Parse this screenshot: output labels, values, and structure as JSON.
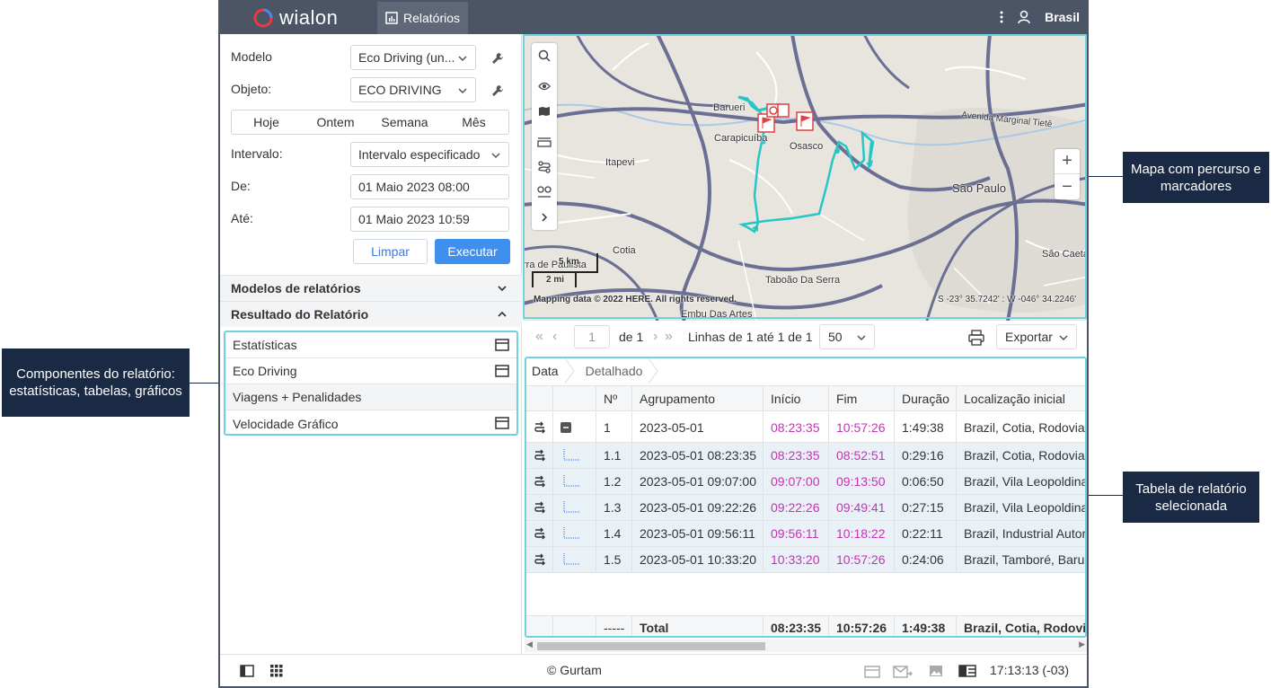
{
  "callouts": {
    "components": "Componentes do relatório: estatísticas, tabelas, gráficos",
    "map": "Mapa com percurso e marcadores",
    "table": "Tabela de relatório selecionada"
  },
  "header": {
    "logo": "wialon",
    "active_tab": "Relatórios",
    "user": "Brasil"
  },
  "form": {
    "model_label": "Modelo",
    "model_value": "Eco Driving (un...",
    "object_label": "Objeto:",
    "object_value": "ECO DRIVING",
    "periods": [
      "Hoje",
      "Ontem",
      "Semana",
      "Mês"
    ],
    "interval_label": "Intervalo:",
    "interval_value": "Intervalo especificado",
    "from_label": "De:",
    "from_value": "01 Maio 2023 08:00",
    "to_label": "Até:",
    "to_value": "01 Maio 2023 10:59",
    "clear_label": "Limpar",
    "run_label": "Executar"
  },
  "sections": {
    "templates": "Modelos de relatórios",
    "result": "Resultado do Relatório"
  },
  "components": [
    {
      "label": "Estatísticas",
      "icon": "table-icon"
    },
    {
      "label": "Eco Driving",
      "icon": "table-icon"
    },
    {
      "label": "Viagens + Penalidades",
      "icon": ""
    },
    {
      "label": "Velocidade Gráfico",
      "icon": "table-icon"
    }
  ],
  "map": {
    "labels": {
      "barueri": "Barueri",
      "carapicuiba": "Carapicuíba",
      "osasco": "Osasco",
      "itapevi": "Itapevi",
      "sao_paulo": "São Paulo",
      "cotia": "Cotia",
      "taboao": "Taboão Da Serra",
      "embu": "Embu Das Artes",
      "sao_caetano": "São Caeta",
      "paulista": "rra de Paulista",
      "marginal": "Avenida Marginal Tietê"
    },
    "scale_km": "5 km",
    "scale_mi": "2 mi",
    "attribution": "Mapping data © 2022 HERE. All rights reserved.",
    "coords": "S -23° 35.7242' : W -046° 34.2246'"
  },
  "toolbar": {
    "page": "1",
    "of_pages": "de 1",
    "rows_info": "Linhas de 1 até 1 de 1",
    "per_page": "50",
    "export_label": "Exportar"
  },
  "table": {
    "tabs": [
      "Data",
      "Detalhado"
    ],
    "columns": [
      "Nº",
      "Agrupamento",
      "Início",
      "Fim",
      "Duração",
      "Localização inicial"
    ],
    "rows": [
      {
        "n": "1",
        "group": "2023-05-01",
        "start": "08:23:35",
        "end": "10:57:26",
        "dur": "1:49:38",
        "loc": "Brazil, Cotia, Rodovia"
      },
      {
        "n": "1.1",
        "group": "2023-05-01 08:23:35",
        "start": "08:23:35",
        "end": "08:52:51",
        "dur": "0:29:16",
        "loc": "Brazil, Cotia, Rodovia"
      },
      {
        "n": "1.2",
        "group": "2023-05-01 09:07:00",
        "start": "09:07:00",
        "end": "09:13:50",
        "dur": "0:06:50",
        "loc": "Brazil, Vila Leopoldina"
      },
      {
        "n": "1.3",
        "group": "2023-05-01 09:22:26",
        "start": "09:22:26",
        "end": "09:49:41",
        "dur": "0:27:15",
        "loc": "Brazil, Vila Leopoldina"
      },
      {
        "n": "1.4",
        "group": "2023-05-01 09:56:11",
        "start": "09:56:11",
        "end": "10:18:22",
        "dur": "0:22:11",
        "loc": "Brazil, Industrial Autor"
      },
      {
        "n": "1.5",
        "group": "2023-05-01 10:33:20",
        "start": "10:33:20",
        "end": "10:57:26",
        "dur": "0:24:06",
        "loc": "Brazil, Tamboré, Barue"
      }
    ],
    "total": {
      "n": "-----",
      "group": "Total",
      "start": "08:23:35",
      "end": "10:57:26",
      "dur": "1:49:38",
      "loc": "Brazil, Cotia, Rodovia R"
    }
  },
  "footer": {
    "copyright": "© Gurtam",
    "clock": "17:13:13 (-03)"
  },
  "colors": {
    "header_bg": "#4c5566",
    "accent": "#3f8fef",
    "highlight_border": "#6fd3df",
    "route": "#26c6c6",
    "time_pink": "#c533b4",
    "callout_bg": "#1b2a44"
  }
}
